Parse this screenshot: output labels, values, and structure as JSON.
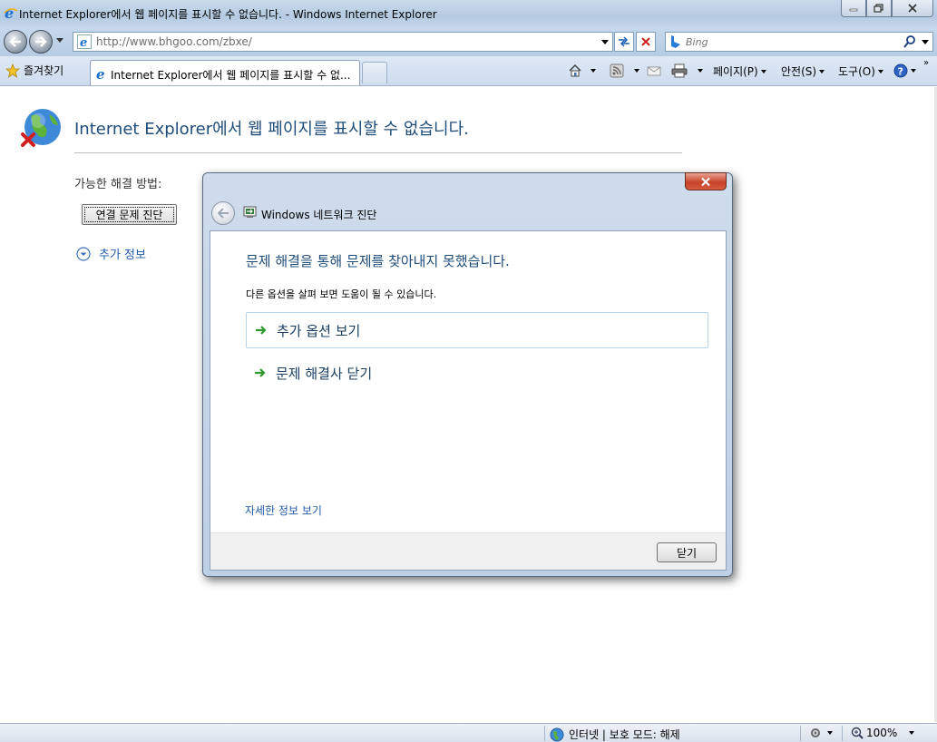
{
  "window": {
    "title": "Internet Explorer에서 웹 페이지를 표시할 수 없습니다. - Windows Internet Explorer"
  },
  "address": {
    "url": "http://www.bhgoo.com/zbxe/"
  },
  "search": {
    "placeholder": "Bing"
  },
  "toolbar": {
    "favorites_label": "즐겨찾기",
    "tab_label": "Internet Explorer에서 웹 페이지를 표시할 수 없...",
    "page_menu": "페이지(P)",
    "safety_menu": "안전(S)",
    "tools_menu": "도구(O)"
  },
  "error_page": {
    "title": "Internet Explorer에서 웹 페이지를 표시할 수 없습니다.",
    "possible_solutions": "가능한 해결 방법:",
    "diagnose_button": "연결 문제 진단",
    "more_info": "추가 정보"
  },
  "dialog": {
    "app_title": "Windows 네트워크 진단",
    "heading": "문제 해결을 통해 문제를 찾아내지 못했습니다.",
    "subtext": "다른 옵션을 살펴 보면 도움이 될 수 있습니다.",
    "option_more": "추가 옵션 보기",
    "option_close": "문제 해결사 닫기",
    "details_link": "자세한 정보 보기",
    "close_button": "닫기"
  },
  "statusbar": {
    "zone": "인터넷 | 보호 모드: 해제",
    "zoom": "100%"
  },
  "colors": {
    "heading_blue": "#1f4d7a",
    "link_blue": "#1e5aa8",
    "arrow_green": "#2e9a2e"
  }
}
